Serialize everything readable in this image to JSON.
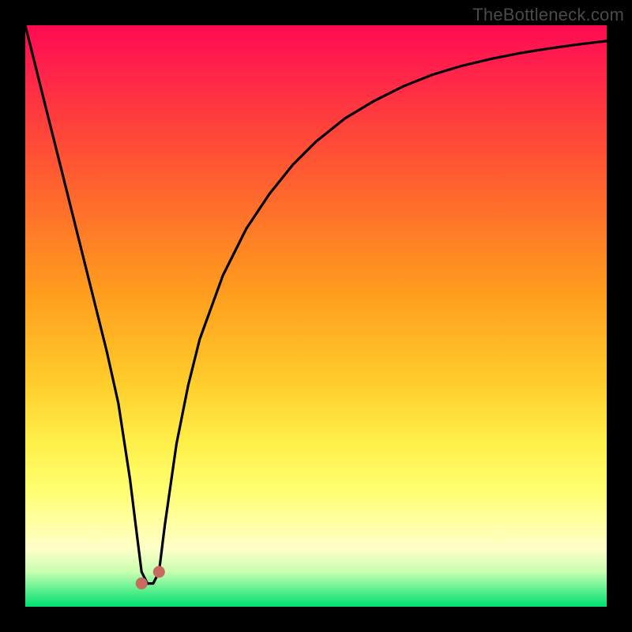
{
  "watermark": "TheBottleneck.com",
  "colors": {
    "frame": "#000000",
    "curve": "#000000",
    "knob": "#c76a60"
  },
  "chart_data": {
    "type": "line",
    "title": "",
    "xlabel": "",
    "ylabel": "",
    "xlim": [
      0,
      100
    ],
    "ylim": [
      0,
      100
    ],
    "grid": false,
    "legend": false,
    "annotations": [
      "TheBottleneck.com"
    ],
    "series": [
      {
        "name": "bottleneck-curve",
        "x": [
          0,
          2,
          4,
          6,
          8,
          10,
          12,
          14,
          16,
          18,
          19,
          20,
          21,
          22,
          23,
          24,
          26,
          28,
          30,
          34,
          38,
          42,
          46,
          50,
          55,
          60,
          65,
          70,
          75,
          80,
          85,
          90,
          95,
          100
        ],
        "y": [
          100,
          92,
          84,
          76,
          68,
          60,
          52,
          44,
          35,
          22,
          14,
          6,
          4,
          4,
          6,
          14,
          28,
          38,
          46,
          57,
          65,
          71,
          76,
          80,
          84,
          87,
          89.5,
          91.5,
          93,
          94.2,
          95.2,
          96,
          96.7,
          97.3
        ]
      }
    ],
    "markers": [
      {
        "name": "knob-left",
        "x": 20,
        "y": 4
      },
      {
        "name": "knob-right",
        "x": 23,
        "y": 6
      }
    ]
  }
}
